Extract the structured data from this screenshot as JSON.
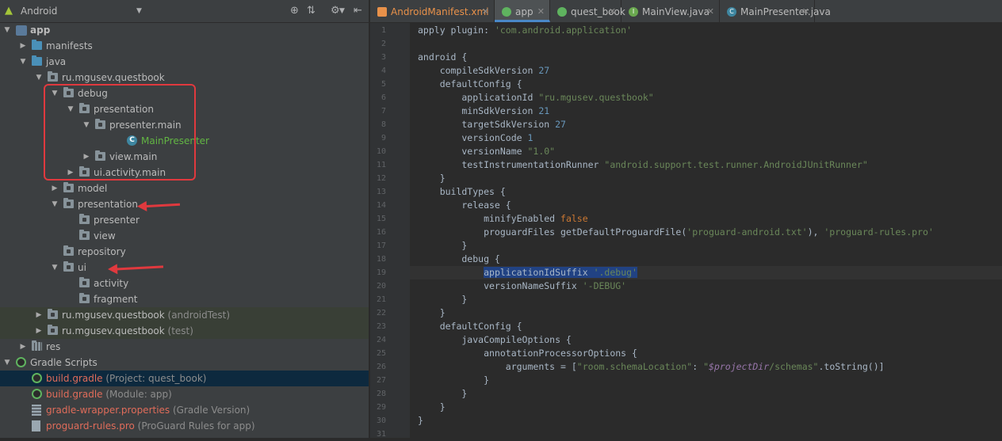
{
  "left_panel": {
    "view_selector": "Android",
    "tree": [
      {
        "label": "app",
        "extra": "",
        "level": 0,
        "arrow": "down",
        "icon": "gradle-root",
        "style": "bold"
      },
      {
        "label": "manifests",
        "extra": "",
        "level": 1,
        "arrow": "right",
        "icon": "folder-blue"
      },
      {
        "label": "java",
        "extra": "",
        "level": 1,
        "arrow": "down",
        "icon": "folder-blue"
      },
      {
        "label": "ru.mgusev.questbook",
        "extra": "",
        "level": 2,
        "arrow": "down",
        "icon": "pkg"
      },
      {
        "label": "debug",
        "extra": "",
        "level": 3,
        "arrow": "down",
        "icon": "pkg"
      },
      {
        "label": "presentation",
        "extra": "",
        "level": 4,
        "arrow": "down",
        "icon": "pkg"
      },
      {
        "label": "presenter.main",
        "extra": "",
        "level": 5,
        "arrow": "down",
        "icon": "pkg"
      },
      {
        "label": "MainPresenter",
        "extra": "",
        "level": 7,
        "arrow": "",
        "icon": "class",
        "style": "green"
      },
      {
        "label": "view.main",
        "extra": "",
        "level": 5,
        "arrow": "right",
        "icon": "pkg"
      },
      {
        "label": "ui.activity.main",
        "extra": "",
        "level": 4,
        "arrow": "right",
        "icon": "pkg"
      },
      {
        "label": "model",
        "extra": "",
        "level": 3,
        "arrow": "right",
        "icon": "pkg"
      },
      {
        "label": "presentation",
        "extra": "",
        "level": 3,
        "arrow": "down",
        "icon": "pkg"
      },
      {
        "label": "presenter",
        "extra": "",
        "level": 4,
        "arrow": "",
        "icon": "pkg"
      },
      {
        "label": "view",
        "extra": "",
        "level": 4,
        "arrow": "",
        "icon": "pkg"
      },
      {
        "label": "repository",
        "extra": "",
        "level": 3,
        "arrow": "",
        "icon": "pkg"
      },
      {
        "label": "ui",
        "extra": "",
        "level": 3,
        "arrow": "down",
        "icon": "pkg"
      },
      {
        "label": "activity",
        "extra": "",
        "level": 4,
        "arrow": "",
        "icon": "pkg"
      },
      {
        "label": "fragment",
        "extra": "",
        "level": 4,
        "arrow": "",
        "icon": "pkg"
      },
      {
        "label": "ru.mgusev.questbook",
        "extra": "(androidTest)",
        "level": 2,
        "arrow": "right",
        "icon": "pkg",
        "highlight": "green"
      },
      {
        "label": "ru.mgusev.questbook",
        "extra": "(test)",
        "level": 2,
        "arrow": "right",
        "icon": "pkg",
        "highlight": "green"
      },
      {
        "label": "res",
        "extra": "",
        "level": 1,
        "arrow": "right",
        "icon": "res"
      },
      {
        "label": "Gradle Scripts",
        "extra": "",
        "level": 0,
        "arrow": "down",
        "icon": "gradle"
      },
      {
        "label": "build.gradle",
        "extra": "(Project: quest_book)",
        "level": 1,
        "arrow": "",
        "icon": "gradle",
        "style": "red",
        "highlight": "sel"
      },
      {
        "label": "build.gradle",
        "extra": "(Module: app)",
        "level": 1,
        "arrow": "",
        "icon": "gradle",
        "style": "red"
      },
      {
        "label": "gradle-wrapper.properties",
        "extra": "(Gradle Version)",
        "level": 1,
        "arrow": "",
        "icon": "props",
        "style": "red"
      },
      {
        "label": "proguard-rules.pro",
        "extra": "(ProGuard Rules for app)",
        "level": 1,
        "arrow": "",
        "icon": "propsfile",
        "style": "red"
      }
    ]
  },
  "tabs": [
    {
      "label": "AndroidManifest.xml",
      "icon": "xml-icon",
      "active": false
    },
    {
      "label": "app",
      "icon": "gradle-icon",
      "active": true
    },
    {
      "label": "quest_book",
      "icon": "gradle-icon",
      "active": false
    },
    {
      "label": "MainView.java",
      "icon": "interface-icon",
      "active": false
    },
    {
      "label": "MainPresenter.java",
      "icon": "class-icon",
      "active": false
    }
  ],
  "editor": {
    "current_line": 19,
    "lines": [
      [
        [
          "apply plugin: ",
          "p"
        ],
        [
          "'com.android.application'",
          "s"
        ]
      ],
      [],
      [
        [
          "android {",
          "p"
        ]
      ],
      [
        [
          "    compileSdkVersion ",
          "p"
        ],
        [
          "27",
          "n"
        ]
      ],
      [
        [
          "    defaultConfig {",
          "p"
        ]
      ],
      [
        [
          "        applicationId ",
          "p"
        ],
        [
          "\"ru.mgusev.questbook\"",
          "s"
        ]
      ],
      [
        [
          "        minSdkVersion ",
          "p"
        ],
        [
          "21",
          "n"
        ]
      ],
      [
        [
          "        targetSdkVersion ",
          "p"
        ],
        [
          "27",
          "n"
        ]
      ],
      [
        [
          "        versionCode ",
          "p"
        ],
        [
          "1",
          "n"
        ]
      ],
      [
        [
          "        versionName ",
          "p"
        ],
        [
          "\"1.0\"",
          "s"
        ]
      ],
      [
        [
          "        testInstrumentationRunner ",
          "p"
        ],
        [
          "\"android.support.test.runner.AndroidJUnitRunner\"",
          "s"
        ]
      ],
      [
        [
          "    }",
          "p"
        ]
      ],
      [
        [
          "    buildTypes {",
          "p"
        ]
      ],
      [
        [
          "        release {",
          "p"
        ]
      ],
      [
        [
          "            minifyEnabled ",
          "p"
        ],
        [
          "false",
          "k"
        ]
      ],
      [
        [
          "            proguardFiles getDefaultProguardFile(",
          "p"
        ],
        [
          "'proguard-android.txt'",
          "s"
        ],
        [
          "), ",
          "p"
        ],
        [
          "'proguard-rules.pro'",
          "s"
        ]
      ],
      [
        [
          "        }",
          "p"
        ]
      ],
      [
        [
          "        debug {",
          "p"
        ]
      ],
      [
        [
          "            ",
          "p"
        ],
        [
          "applicationIdSuffix ",
          "x"
        ],
        [
          "'.debug'",
          "xs"
        ]
      ],
      [
        [
          "            versionNameSuffix ",
          "p"
        ],
        [
          "'-DEBUG'",
          "s"
        ]
      ],
      [
        [
          "        }",
          "p"
        ]
      ],
      [
        [
          "    }",
          "p"
        ]
      ],
      [
        [
          "    defaultConfig {",
          "p"
        ]
      ],
      [
        [
          "        javaCompileOptions {",
          "p"
        ]
      ],
      [
        [
          "            annotationProcessorOptions {",
          "p"
        ]
      ],
      [
        [
          "                arguments = [",
          "p"
        ],
        [
          "\"room.schemaLocation\"",
          "s"
        ],
        [
          ": ",
          "p"
        ],
        [
          "\"",
          "s"
        ],
        [
          "$projectDir",
          "i"
        ],
        [
          "/schemas\"",
          "s"
        ],
        [
          ".toString()]",
          "p"
        ]
      ],
      [
        [
          "            }",
          "p"
        ]
      ],
      [
        [
          "        }",
          "p"
        ]
      ],
      [
        [
          "    }",
          "p"
        ]
      ],
      [
        [
          "}",
          "p"
        ]
      ],
      []
    ]
  },
  "colors": {
    "accent": "#4a88c7",
    "annotation": "#e0393e",
    "string": "#6a8759",
    "keyword": "#cc7832",
    "number": "#6897bb"
  }
}
